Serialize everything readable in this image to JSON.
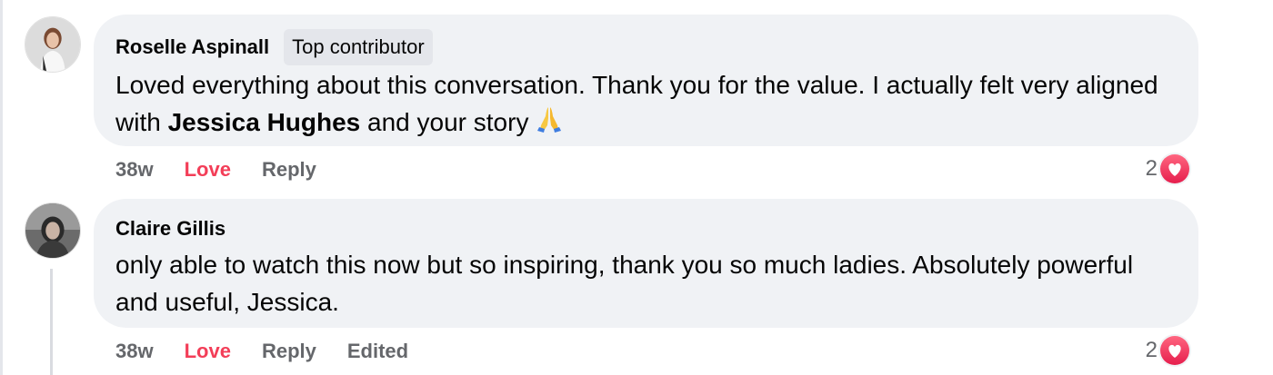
{
  "comments": [
    {
      "author": "Roselle Aspinall",
      "badge": "Top contributor",
      "text_before": "Loved everything about this conversation. Thank you for the value. I actually felt very aligned with ",
      "mention": "Jessica Hughes",
      "text_after": " and your story",
      "emoji": "folded-hands-emoji",
      "time": "38w",
      "love_label": "Love",
      "reply_label": "Reply",
      "reaction_count": "2",
      "reaction_type": "heart-icon"
    },
    {
      "author": "Claire Gillis",
      "text": "only able to watch this now but so inspiring, thank you so much ladies. Absolutely powerful and useful, Jessica.",
      "time": "38w",
      "love_label": "Love",
      "reply_label": "Reply",
      "edited_label": "Edited",
      "reaction_count": "2",
      "reaction_type": "heart-icon"
    }
  ],
  "colors": {
    "bubble": "#f0f2f5",
    "love": "#f33e58",
    "meta": "#65676b",
    "heart_top": "#ff6680",
    "heart_bottom": "#e61e4d"
  }
}
